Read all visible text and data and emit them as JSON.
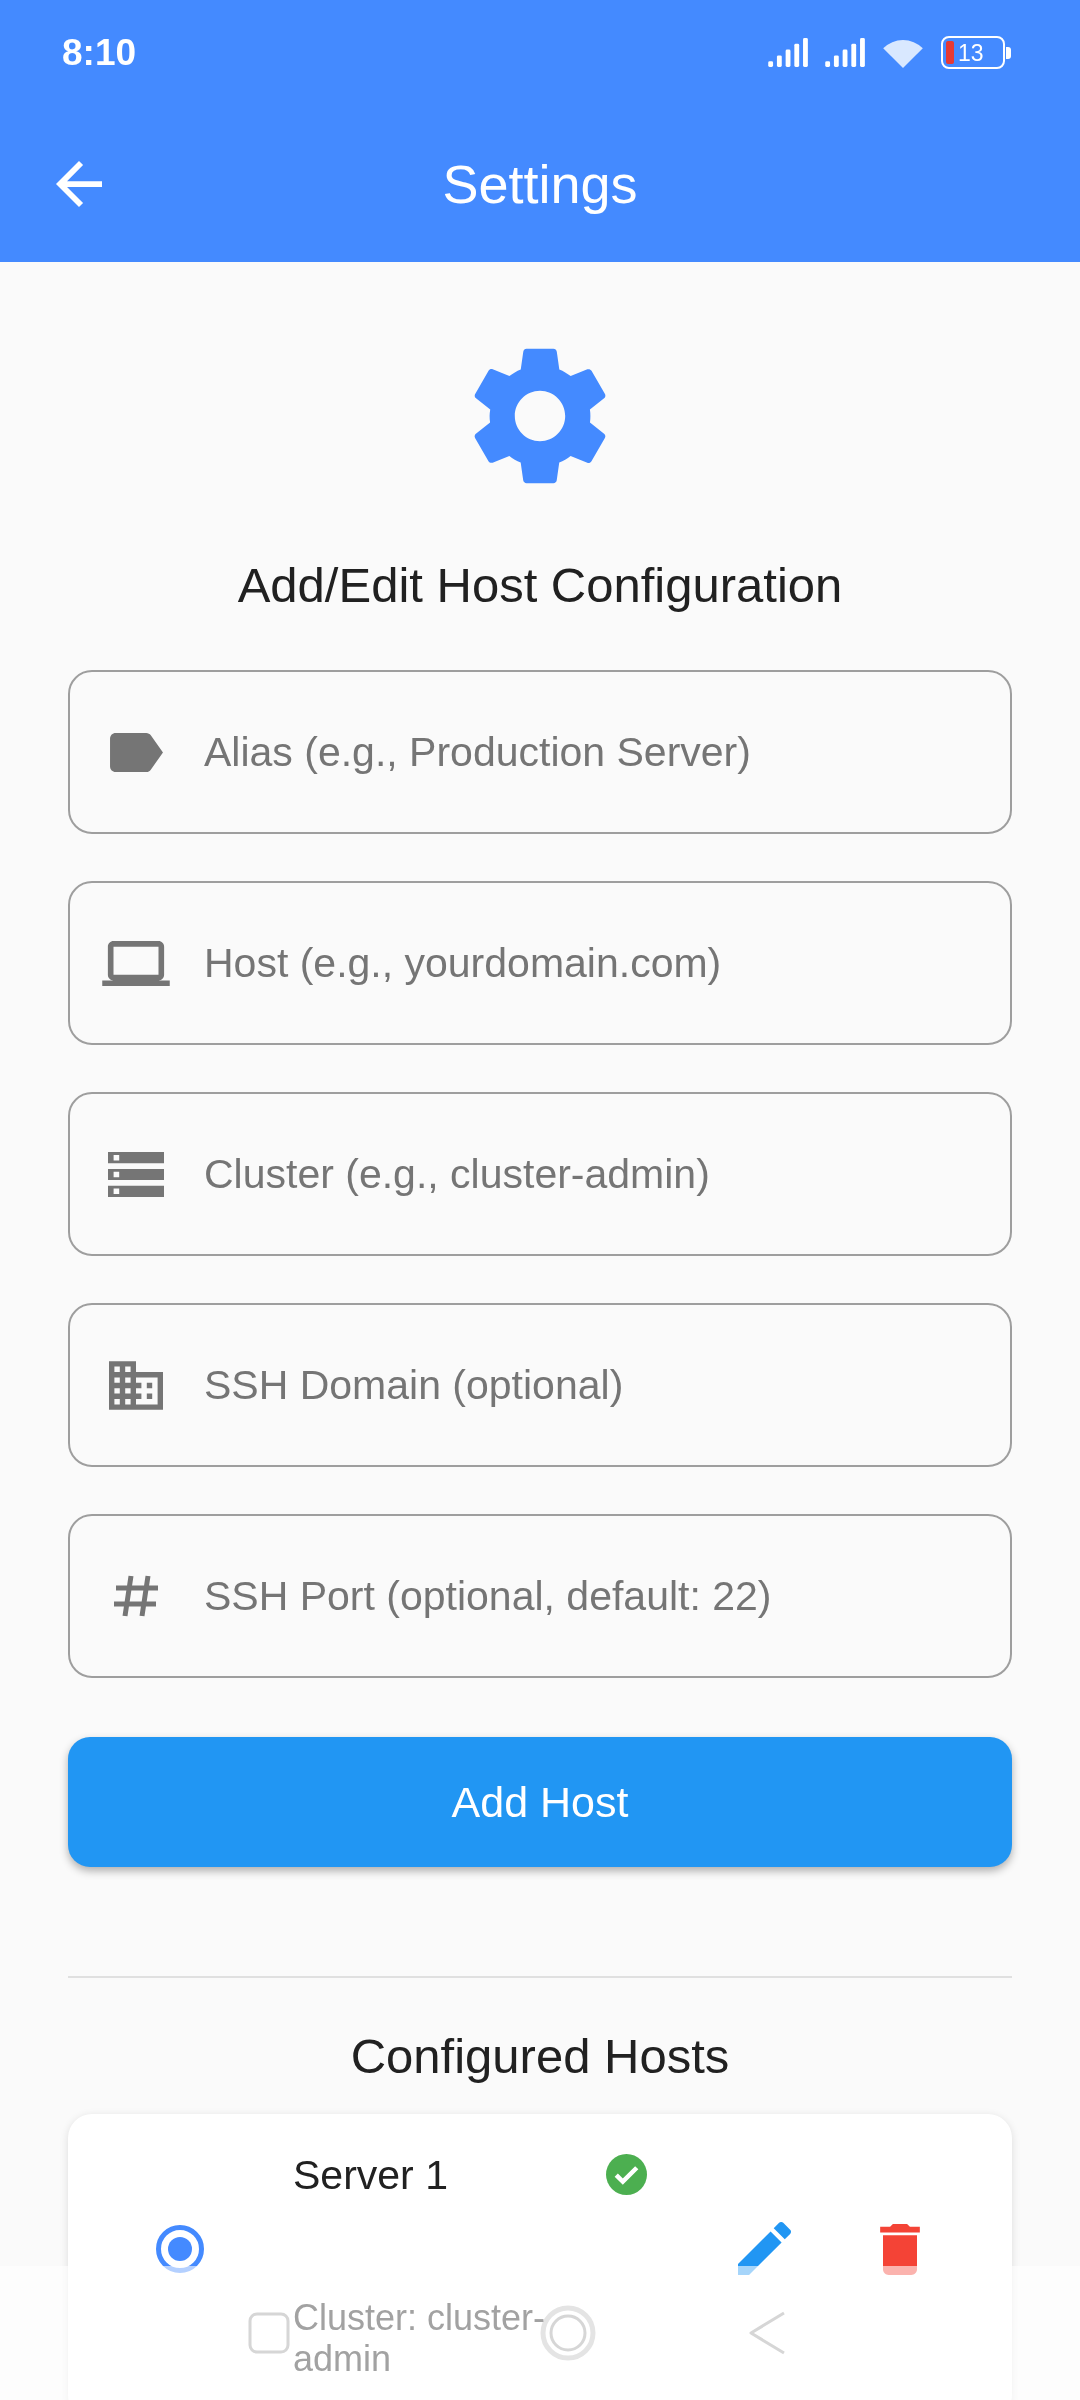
{
  "status_bar": {
    "time": "8:10",
    "battery": "13"
  },
  "app_bar": {
    "title": "Settings"
  },
  "form": {
    "heading": "Add/Edit Host Configuration",
    "fields": [
      {
        "kind": "alias",
        "placeholder": "Alias (e.g., Production Server)"
      },
      {
        "kind": "host",
        "placeholder": "Host (e.g., yourdomain.com)"
      },
      {
        "kind": "cluster",
        "placeholder": "Cluster (e.g., cluster-admin)"
      },
      {
        "kind": "domain",
        "placeholder": "SSH Domain (optional)"
      },
      {
        "kind": "port",
        "placeholder": "SSH Port (optional, default: 22)"
      }
    ],
    "submit_button": "Add Host"
  },
  "hosts": {
    "heading": "Configured Hosts",
    "items": [
      {
        "name": "Server 1",
        "selected": true,
        "connected": true,
        "cluster": "Cluster: cluster-admin"
      }
    ]
  }
}
